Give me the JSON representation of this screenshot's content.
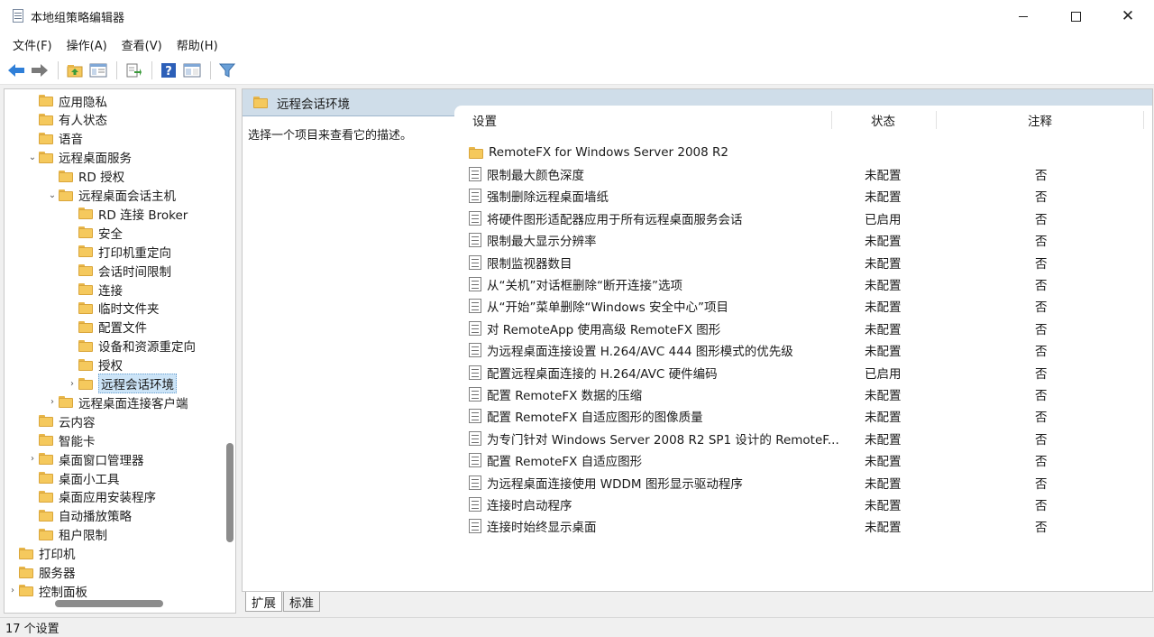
{
  "window": {
    "title": "本地组策略编辑器",
    "minimize": "—",
    "maximize": "□",
    "close": "✕"
  },
  "menu": [
    {
      "label": "文件(F)"
    },
    {
      "label": "操作(A)"
    },
    {
      "label": "查看(V)"
    },
    {
      "label": "帮助(H)"
    }
  ],
  "toolbar": {
    "icons": [
      "back-arrow-icon",
      "forward-arrow-icon",
      "up-folder-icon",
      "show-hide-tree-icon",
      "export-list-icon",
      "help-icon",
      "properties-view-icon",
      "filter-icon"
    ]
  },
  "tree": {
    "items": [
      {
        "label": "应用隐私",
        "indent": 2,
        "expander": ""
      },
      {
        "label": "有人状态",
        "indent": 2,
        "expander": ""
      },
      {
        "label": "语音",
        "indent": 2,
        "expander": ""
      },
      {
        "label": "远程桌面服务",
        "indent": 2,
        "expander": "⌄"
      },
      {
        "label": "RD 授权",
        "indent": 3,
        "expander": ""
      },
      {
        "label": "远程桌面会话主机",
        "indent": 3,
        "expander": "⌄"
      },
      {
        "label": "RD 连接 Broker",
        "indent": 4,
        "expander": ""
      },
      {
        "label": "安全",
        "indent": 4,
        "expander": ""
      },
      {
        "label": "打印机重定向",
        "indent": 4,
        "expander": ""
      },
      {
        "label": "会话时间限制",
        "indent": 4,
        "expander": ""
      },
      {
        "label": "连接",
        "indent": 4,
        "expander": ""
      },
      {
        "label": "临时文件夹",
        "indent": 4,
        "expander": ""
      },
      {
        "label": "配置文件",
        "indent": 4,
        "expander": ""
      },
      {
        "label": "设备和资源重定向",
        "indent": 4,
        "expander": ""
      },
      {
        "label": "授权",
        "indent": 4,
        "expander": ""
      },
      {
        "label": "远程会话环境",
        "indent": 4,
        "expander": "›",
        "selected": true
      },
      {
        "label": "远程桌面连接客户端",
        "indent": 3,
        "expander": "›"
      },
      {
        "label": "云内容",
        "indent": 2,
        "expander": ""
      },
      {
        "label": "智能卡",
        "indent": 2,
        "expander": ""
      },
      {
        "label": "桌面窗口管理器",
        "indent": 2,
        "expander": "›"
      },
      {
        "label": "桌面小工具",
        "indent": 2,
        "expander": ""
      },
      {
        "label": "桌面应用安装程序",
        "indent": 2,
        "expander": ""
      },
      {
        "label": "自动播放策略",
        "indent": 2,
        "expander": ""
      },
      {
        "label": "租户限制",
        "indent": 2,
        "expander": ""
      },
      {
        "label": "打印机",
        "indent": 1,
        "expander": ""
      },
      {
        "label": "服务器",
        "indent": 1,
        "expander": ""
      },
      {
        "label": "控制面板",
        "indent": 1,
        "expander": "›"
      }
    ]
  },
  "content": {
    "header_title": "远程会话环境",
    "description": "选择一个项目来查看它的描述。",
    "columns": {
      "setting": "设置",
      "state": "状态",
      "note": "注释"
    },
    "folder_row": "RemoteFX for Windows Server 2008 R2",
    "rows": [
      {
        "name": "限制最大颜色深度",
        "state": "未配置",
        "note": "否"
      },
      {
        "name": "强制删除远程桌面墙纸",
        "state": "未配置",
        "note": "否"
      },
      {
        "name": "将硬件图形适配器应用于所有远程桌面服务会话",
        "state": "已启用",
        "note": "否"
      },
      {
        "name": "限制最大显示分辨率",
        "state": "未配置",
        "note": "否"
      },
      {
        "name": "限制监视器数目",
        "state": "未配置",
        "note": "否"
      },
      {
        "name": "从“关机”对话框删除“断开连接”选项",
        "state": "未配置",
        "note": "否"
      },
      {
        "name": "从“开始”菜单删除“Windows 安全中心”项目",
        "state": "未配置",
        "note": "否"
      },
      {
        "name": "对 RemoteApp 使用高级 RemoteFX 图形",
        "state": "未配置",
        "note": "否"
      },
      {
        "name": "为远程桌面连接设置 H.264/AVC 444 图形模式的优先级",
        "state": "未配置",
        "note": "否"
      },
      {
        "name": "配置远程桌面连接的 H.264/AVC 硬件编码",
        "state": "已启用",
        "note": "否"
      },
      {
        "name": "配置 RemoteFX 数据的压缩",
        "state": "未配置",
        "note": "否"
      },
      {
        "name": "配置 RemoteFX 自适应图形的图像质量",
        "state": "未配置",
        "note": "否"
      },
      {
        "name": "为专门针对 Windows Server 2008 R2 SP1 设计的 RemoteF...",
        "state": "未配置",
        "note": "否"
      },
      {
        "name": "配置 RemoteFX 自适应图形",
        "state": "未配置",
        "note": "否"
      },
      {
        "name": "为远程桌面连接使用 WDDM 图形显示驱动程序",
        "state": "未配置",
        "note": "否"
      },
      {
        "name": "连接时启动程序",
        "state": "未配置",
        "note": "否"
      },
      {
        "name": "连接时始终显示桌面",
        "state": "未配置",
        "note": "否"
      }
    ]
  },
  "tabs": [
    {
      "label": "扩展",
      "active": true
    },
    {
      "label": "标准",
      "active": false
    }
  ],
  "status": {
    "text": "17 个设置"
  },
  "colors": {
    "header_bg": "#cfdde9",
    "folder": "#f5c95d",
    "selection": "#cce4f7"
  }
}
